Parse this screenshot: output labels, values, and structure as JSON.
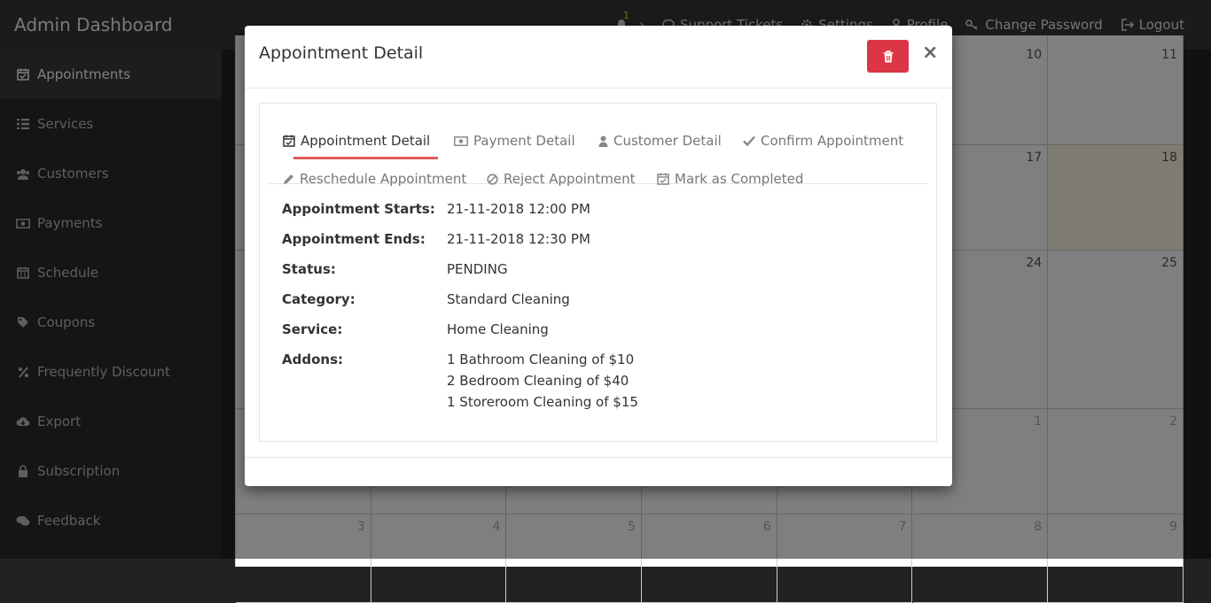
{
  "app": {
    "title": "Admin Dashboard"
  },
  "topnav": {
    "notification_count": "1",
    "support": "Support Tickets",
    "settings": "Settings",
    "profile": "Profile",
    "change_password": "Change Password",
    "logout": "Logout"
  },
  "sidebar": {
    "items": [
      {
        "label": "Appointments",
        "icon": "calendar-check-icon"
      },
      {
        "label": "Services",
        "icon": "list-icon"
      },
      {
        "label": "Customers",
        "icon": "users-icon"
      },
      {
        "label": "Payments",
        "icon": "money-icon"
      },
      {
        "label": "Schedule",
        "icon": "calendar-icon"
      },
      {
        "label": "Coupons",
        "icon": "tag-icon"
      },
      {
        "label": "Frequently Discount",
        "icon": "percent-icon"
      },
      {
        "label": "Export",
        "icon": "cloud-download-icon"
      },
      {
        "label": "Subscription",
        "icon": "lock-icon"
      },
      {
        "label": "Feedback",
        "icon": "comments-icon"
      }
    ]
  },
  "calendar": {
    "rows": [
      [
        "",
        "",
        "",
        "",
        "",
        "10",
        "11"
      ],
      [
        "",
        "",
        "",
        "",
        "",
        "17",
        "18"
      ],
      [
        "",
        "",
        "",
        "",
        "",
        "24",
        "25"
      ],
      [
        "",
        "",
        "",
        "",
        "",
        "1",
        "2"
      ],
      [
        "3",
        "4",
        "5",
        "6",
        "7",
        "8",
        "9"
      ]
    ]
  },
  "modal": {
    "title": "Appointment Detail",
    "tabs": [
      {
        "label": "Appointment Detail",
        "icon": "calendar-check-icon"
      },
      {
        "label": "Payment Detail",
        "icon": "money-icon"
      },
      {
        "label": "Customer Detail",
        "icon": "user-icon"
      },
      {
        "label": "Confirm Appointment",
        "icon": "check-icon"
      },
      {
        "label": "Reschedule Appointment",
        "icon": "pencil-icon"
      },
      {
        "label": "Reject Appointment",
        "icon": "ban-icon"
      },
      {
        "label": "Mark as Completed",
        "icon": "calendar-check-icon"
      }
    ],
    "details": {
      "starts_label": "Appointment Starts:",
      "starts_value": "21-11-2018 12:00 PM",
      "ends_label": "Appointment Ends:",
      "ends_value": "21-11-2018 12:30 PM",
      "status_label": "Status:",
      "status_value": "PENDING",
      "category_label": "Category:",
      "category_value": "Standard Cleaning",
      "service_label": "Service:",
      "service_value": "Home Cleaning",
      "addons_label": "Addons:",
      "addons": [
        "1 Bathroom Cleaning of $10",
        "2 Bedroom Cleaning of $40",
        "1 Storeroom Cleaning of $15"
      ]
    }
  },
  "colors": {
    "accent_delete": "#dc3545",
    "active_tab_underline": "#e05a5a",
    "today_highlight": "#fcf8e3"
  }
}
